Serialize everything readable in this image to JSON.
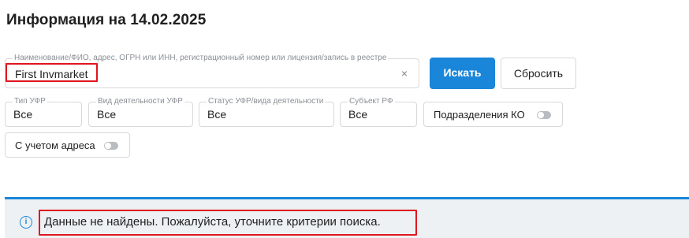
{
  "page": {
    "title": "Информация на 14.02.2025"
  },
  "search": {
    "label": "Наименование/ФИО, адрес, ОГРН или ИНН, регистрационный номер или лицензия/запись в реестре",
    "value": "First Invmarket",
    "clear_icon": "close-icon",
    "clear_glyph": "×"
  },
  "buttons": {
    "search_label": "Искать",
    "reset_label": "Сбросить"
  },
  "filters": [
    {
      "label": "Тип УФР",
      "value": "Все"
    },
    {
      "label": "Вид деятельности УФР",
      "value": "Все"
    },
    {
      "label": "Статус УФР/вида деятельности",
      "value": "Все"
    },
    {
      "label": "Субъект РФ",
      "value": "Все"
    }
  ],
  "toggles": {
    "ko_label": "Подразделения КО",
    "ko_on": false,
    "address_label": "С учетом адреса",
    "address_on": false
  },
  "notice": {
    "icon": "info-icon",
    "icon_glyph": "i",
    "text": "Данные не найдены. Пожалуйста, уточните критерии поиска."
  },
  "colors": {
    "accent": "#1a86d9",
    "highlight": "#e0161e",
    "notice_bg": "#eef1f4"
  }
}
